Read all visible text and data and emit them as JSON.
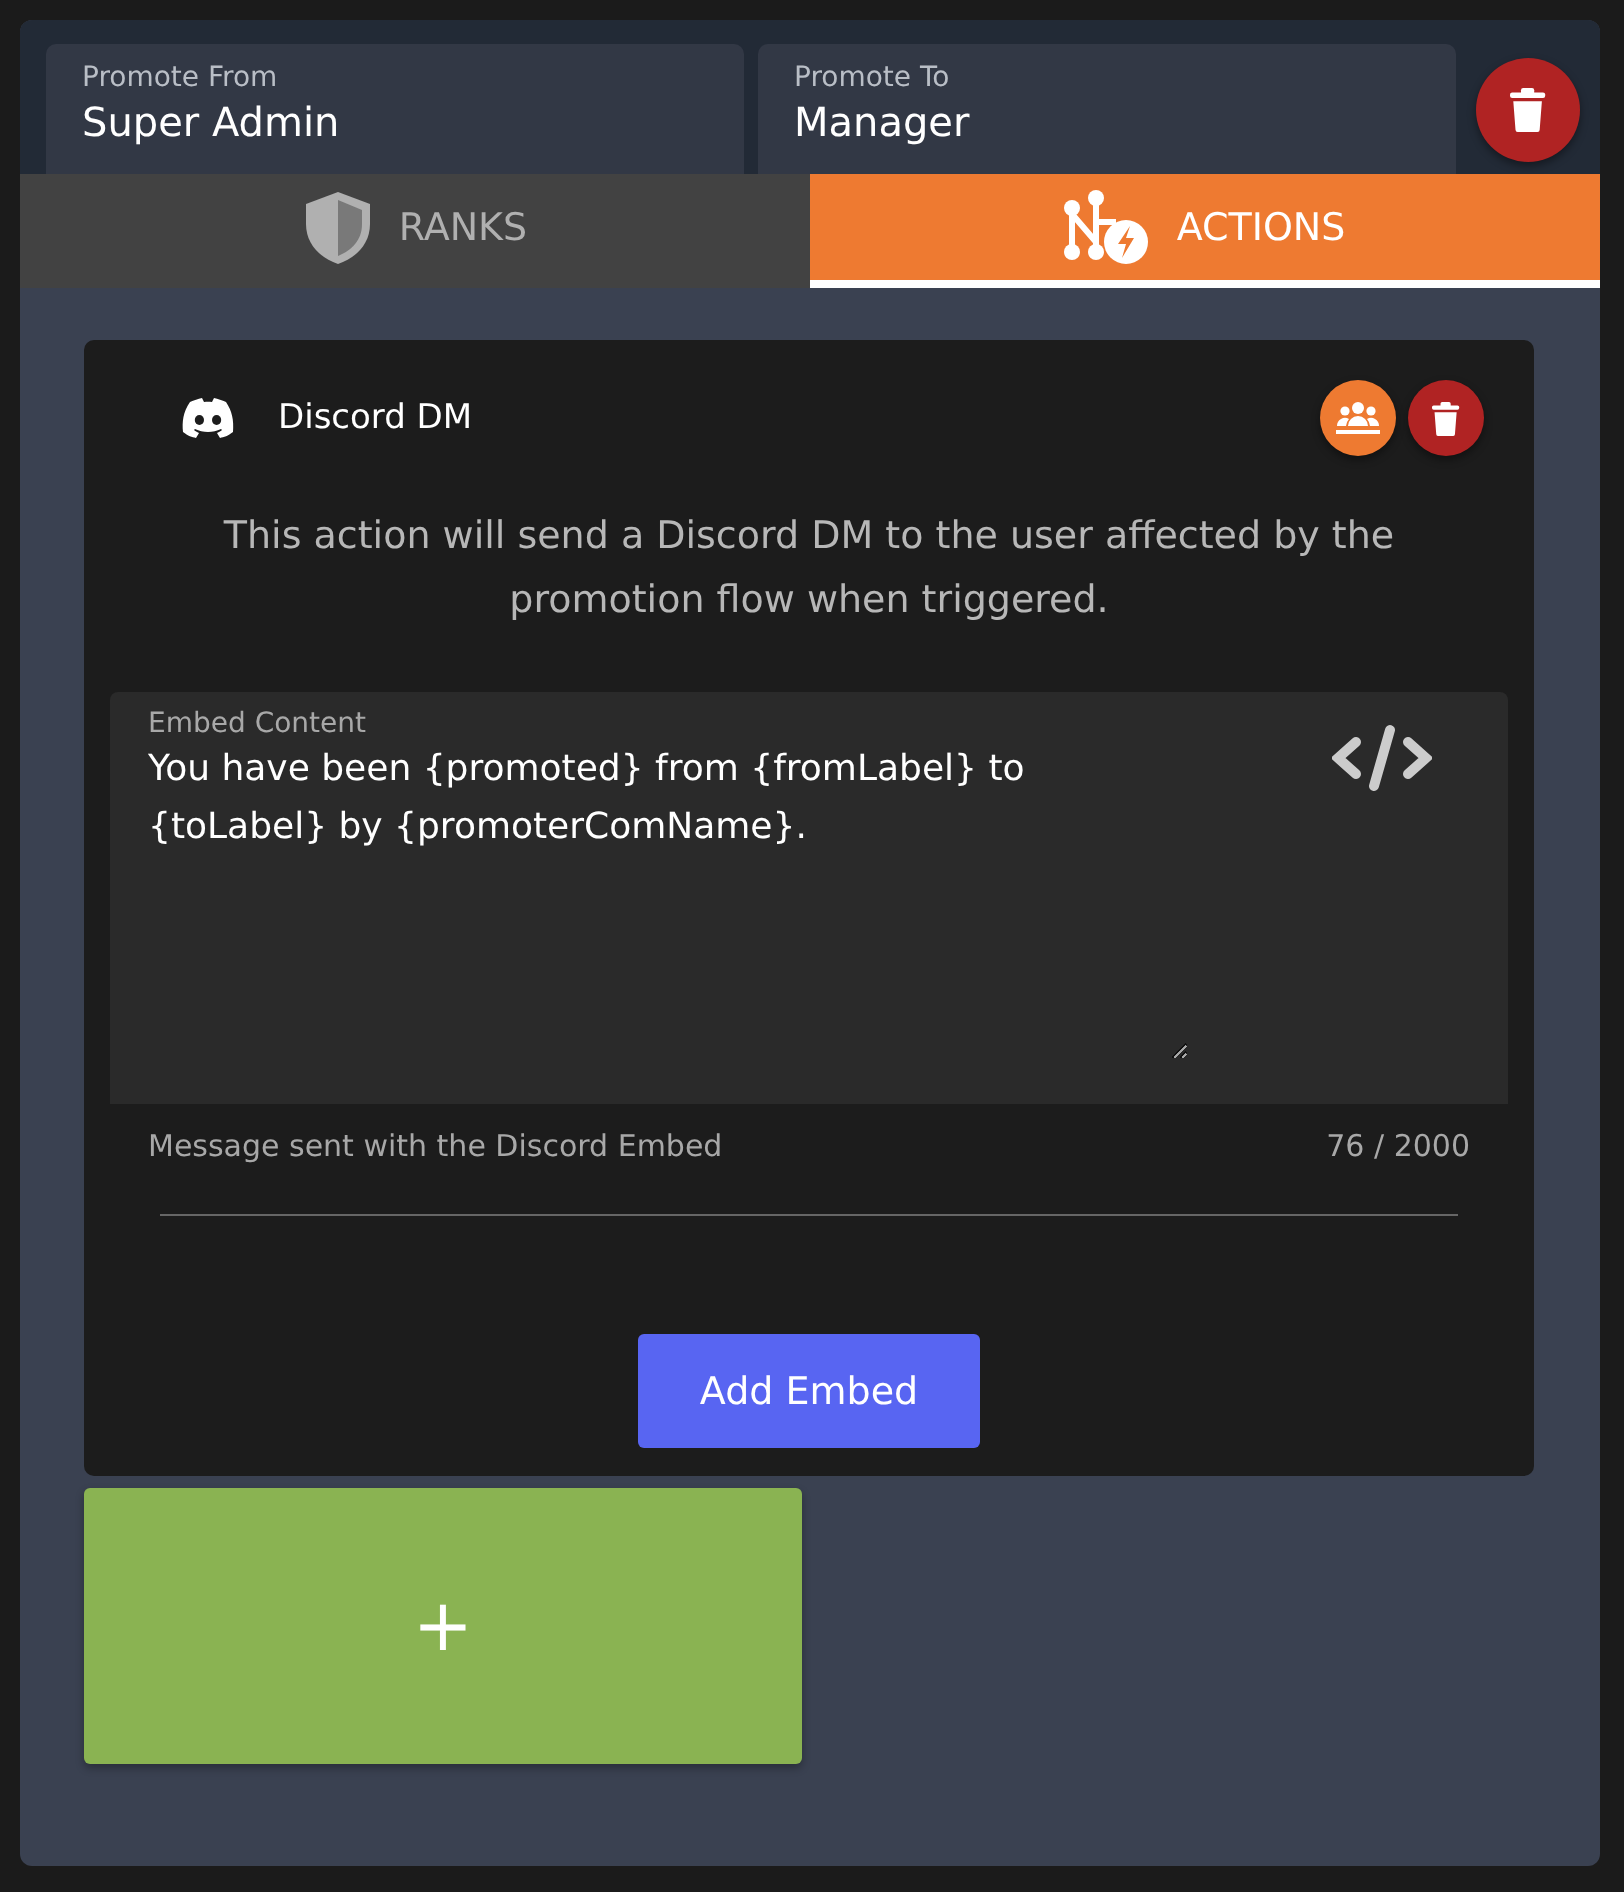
{
  "header": {
    "fields": [
      {
        "label": "Promote From",
        "value": "Super Admin"
      },
      {
        "label": "Promote To",
        "value": "Manager"
      }
    ]
  },
  "tabs": [
    {
      "label": "RANKS",
      "selected": false,
      "kind": "shield"
    },
    {
      "label": "ACTIONS",
      "selected": true,
      "kind": "flow"
    }
  ],
  "action_card": {
    "title": "Discord DM",
    "description": "This action will send a Discord DM to the user affected by the promotion flow when triggered.",
    "embed_field": {
      "label": "Embed Content",
      "value": "You have been {promoted} from {fromLabel} to {toLabel} by {promoterComName}.",
      "helper": "Message sent with the Discord Embed",
      "counter": "76 / 2000"
    },
    "add_button": "Add Embed"
  },
  "add_action": {
    "symbol": "+"
  }
}
